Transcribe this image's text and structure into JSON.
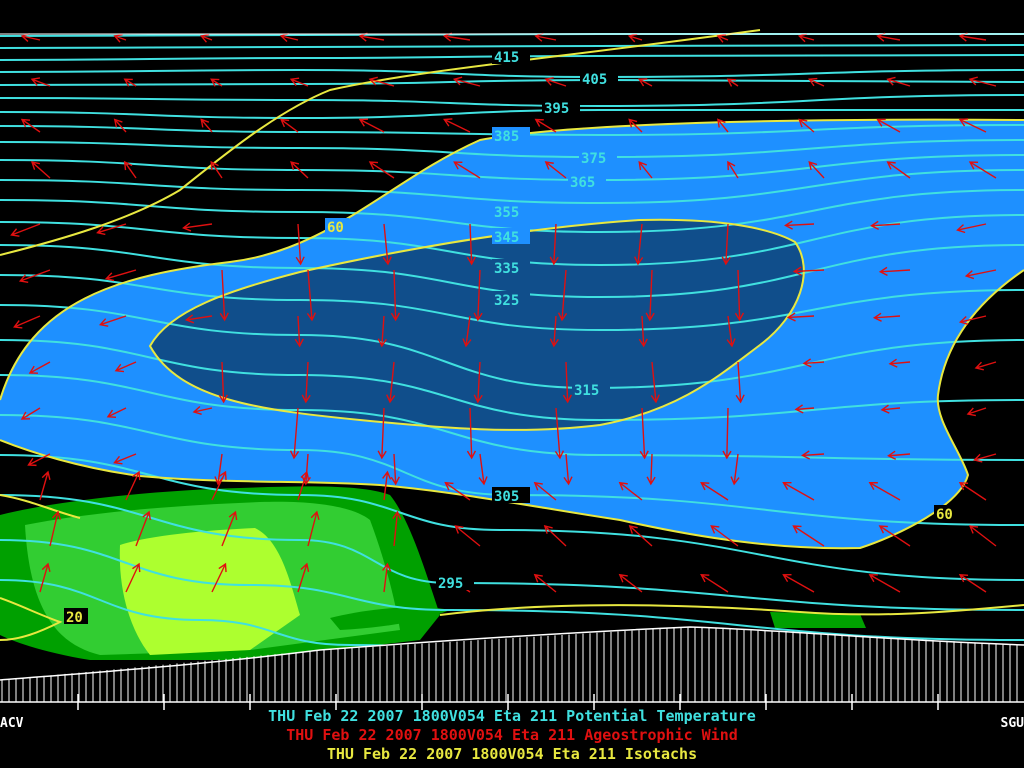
{
  "colors": {
    "background": "#000000",
    "theta": "#40e0e0",
    "ageo": "#e01010",
    "isotach": "#e8e840",
    "fill_60": "#1e90ff",
    "fill_70": "#104e8b",
    "fill_20": "#00a000",
    "fill_30": "#32cd32",
    "fill_40": "#adff2f",
    "terrain": "#ffffff"
  },
  "chart_data": {
    "type": "contour-cross-section",
    "x_endpoints": [
      "ACV",
      "SGU"
    ],
    "theta_levels": [
      295,
      305,
      315,
      325,
      335,
      345,
      355,
      365,
      375,
      385,
      395,
      405,
      415
    ],
    "isotach_levels": [
      20,
      60
    ],
    "labels": {
      "theta": [
        "415",
        "405",
        "395",
        "385",
        "375",
        "365",
        "355",
        "345",
        "335",
        "325",
        "315",
        "305",
        "295"
      ],
      "isotach": [
        "60",
        "60",
        "20"
      ]
    }
  },
  "captions": [
    "THU Feb 22 2007 1800V054 Eta 211 Potential Temperature",
    "THU Feb 22 2007 1800V054 Eta 211 Ageostrophic Wind",
    "THU Feb 22 2007 1800V054 Eta 211 Isotachs"
  ],
  "stations": {
    "left": "ACV",
    "right": "SGU"
  }
}
